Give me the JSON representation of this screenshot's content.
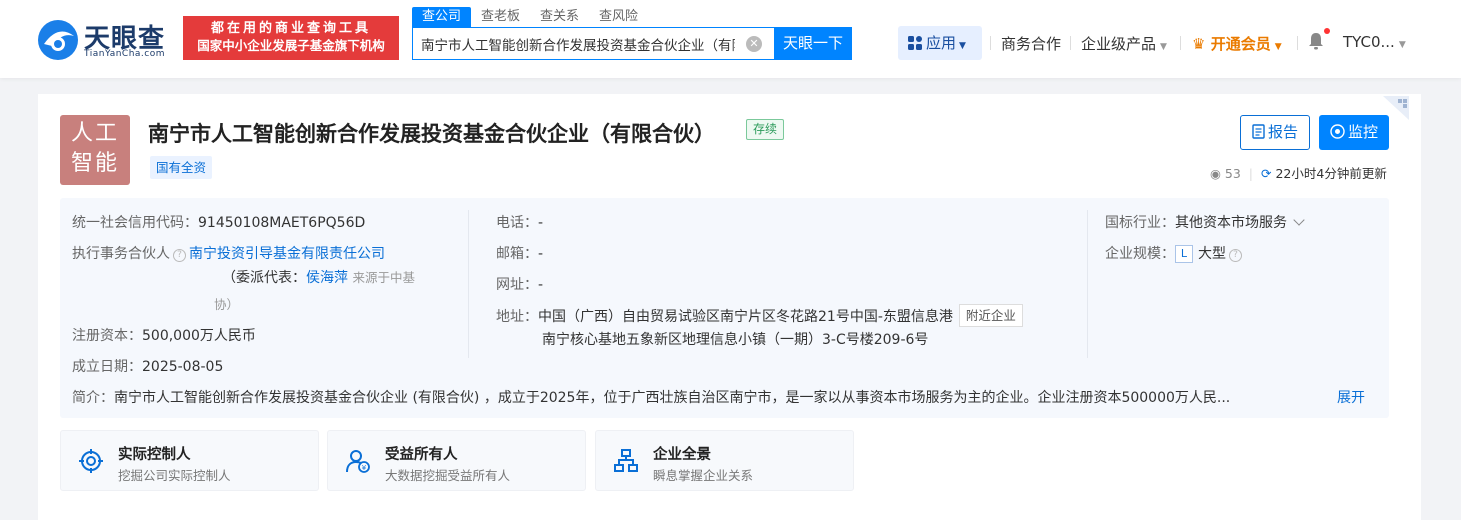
{
  "header": {
    "logo": {
      "name": "天眼查",
      "sub": "TianYanCha.com"
    },
    "slogan": {
      "line1": "都在用的商业查询工具",
      "line2": "国家中小企业发展子基金旗下机构"
    },
    "search_tabs": [
      "查公司",
      "查老板",
      "查关系",
      "查风险"
    ],
    "search_value": "南宁市人工智能创新合作发展投资基金合伙企业（有限",
    "search_button": "天眼一下",
    "nav": {
      "app": "应用",
      "business": "商务合作",
      "enterprise": "企业级产品",
      "vip": "开通会员",
      "user": "TYC0..."
    }
  },
  "company": {
    "avatar_line1": "人工",
    "avatar_line2": "智能",
    "name": "南宁市人工智能创新合作发展投资基金合伙企业（有限合伙）",
    "status": "存续",
    "tag": "国有全资",
    "btn_report": "报告",
    "btn_monitor": "监控",
    "views": "53",
    "updated": "22小时4分钟前更新"
  },
  "info": {
    "credit_code_label": "统一社会信用代码：",
    "credit_code": "91450108MAET6PQ56D",
    "partner_label": "执行事务合伙人",
    "partner": "南宁投资引导基金有限责任公司",
    "delegate_prefix": "（委派代表：",
    "delegate": "侯海萍",
    "delegate_source1": "来源于中基",
    "delegate_source2": "协）",
    "capital_label": "注册资本：",
    "capital": "500,000万人民币",
    "date_label": "成立日期：",
    "date": "2025-08-05",
    "phone_label": "电话：",
    "phone": "-",
    "email_label": "邮箱：",
    "email": "-",
    "website_label": "网址：",
    "website": "-",
    "address_label": "地址：",
    "address_line1": "中国（广西）自由贸易试验区南宁片区冬花路21号中国-东盟信息港",
    "address_line2": "南宁核心基地五象新区地理信息小镇（一期）3-C号楼209-6号",
    "nearby": "附近企业",
    "industry_label": "国标行业：",
    "industry": "其他资本市场服务",
    "scale_label": "企业规模：",
    "scale_badge": "L",
    "scale": "大型",
    "intro_label": "简介：",
    "intro": "南宁市人工智能创新合作发展投资基金合伙企业 (有限合伙) ，成立于2025年，位于广西壮族自治区南宁市，是一家以从事资本市场服务为主的企业。企业注册资本500000万人民...",
    "expand": "展开"
  },
  "features": [
    {
      "title": "实际控制人",
      "desc": "挖掘公司实际控制人"
    },
    {
      "title": "受益所有人",
      "desc": "大数据挖掘受益所有人"
    },
    {
      "title": "企业全景",
      "desc": "瞬息掌握企业关系"
    }
  ],
  "colors": {
    "brand": "#0084ff",
    "slogan_red": "#e43b3b",
    "avatar": "#c8807d",
    "status_green": "#2d9b5b",
    "vip_orange": "#ea7b00"
  }
}
